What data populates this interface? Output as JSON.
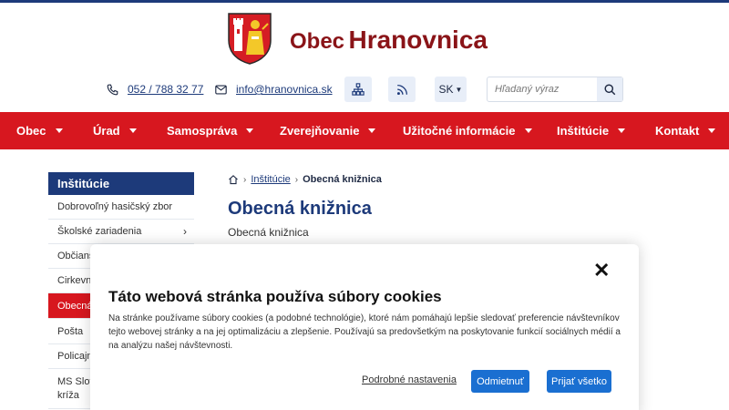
{
  "header": {
    "title_prefix": "Obec",
    "title_main": "Hranovnica",
    "phone": "052 / 788 32 77",
    "email": "info@hranovnica.sk",
    "language": "SK",
    "search_placeholder": "Hľadaný výraz",
    "icons": [
      "phone-icon",
      "mail-icon",
      "sitemap-icon",
      "rss-icon",
      "search-icon"
    ]
  },
  "nav": {
    "items": [
      "Obec",
      "Úrad",
      "Samospráva",
      "Zverejňovanie",
      "Užitočné informácie",
      "Inštitúcie",
      "Kontakt"
    ]
  },
  "sidebar": {
    "heading": "Inštitúcie",
    "items": [
      {
        "label": "Dobrovoľný hasičský zbor"
      },
      {
        "label": "Školské zariadenia"
      },
      {
        "label": "Občians"
      },
      {
        "label": "Cirkevné"
      },
      {
        "label": "Obecná"
      },
      {
        "label": "Pošta"
      },
      {
        "label": "Policajný"
      },
      {
        "label_line1": "MS Slove",
        "label_line2": "kríža"
      }
    ]
  },
  "main": {
    "breadcrumb_parent": "Inštitúcie",
    "breadcrumb_current": "Obecná knižnica",
    "page_title": "Obecná knižnica",
    "subtitle": "Obecná knižnica"
  },
  "cookie": {
    "title": "Táto webová stránka používa súbory cookies",
    "text": "Na stránke používame súbory cookies (a podobné technológie), ktoré nám pomáhajú lepšie sledovať preferencie návštevníkov tejto webovej stránky a na jej optimalizáciu a zlepšenie. Používajú sa predovšetkým na poskytovanie funkcií sociálnych médií a na analýzu našej návštevnosti.",
    "settings_link": "Podrobné nastavenia",
    "reject_label": "Odmietnuť",
    "accept_label": "Prijať všetko"
  },
  "colors": {
    "brand_red": "#d7171f",
    "navy": "#1d3a7a",
    "button_blue": "#1a6fd1"
  }
}
